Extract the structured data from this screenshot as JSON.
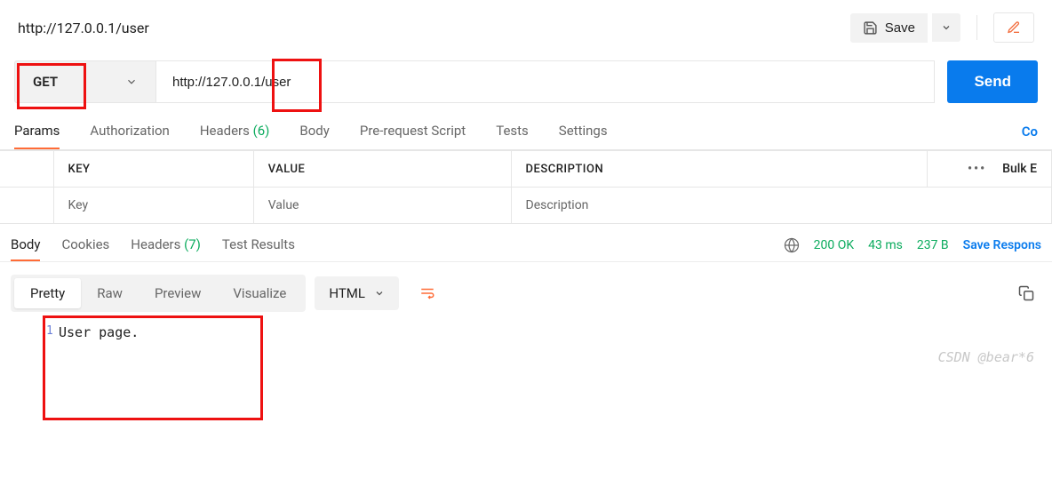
{
  "header": {
    "title": "http://127.0.0.1/user",
    "save_label": "Save"
  },
  "request": {
    "method": "GET",
    "url": "http://127.0.0.1/user",
    "send_label": "Send"
  },
  "req_tabs": {
    "params": "Params",
    "auth": "Authorization",
    "headers_label": "Headers",
    "headers_count": "(6)",
    "body": "Body",
    "prerequest": "Pre-request Script",
    "tests": "Tests",
    "settings": "Settings",
    "right_link": "Co"
  },
  "kv": {
    "key_header": "KEY",
    "value_header": "VALUE",
    "desc_header": "DESCRIPTION",
    "bulk": "Bulk E",
    "key_ph": "Key",
    "value_ph": "Value",
    "desc_ph": "Description"
  },
  "resp_tabs": {
    "body": "Body",
    "cookies": "Cookies",
    "headers_label": "Headers",
    "headers_count": "(7)",
    "test_results": "Test Results"
  },
  "status": {
    "code": "200 OK",
    "time": "43 ms",
    "size": "237 B",
    "save_response": "Save Respons"
  },
  "viewer": {
    "pretty": "Pretty",
    "raw": "Raw",
    "preview": "Preview",
    "visualize": "Visualize",
    "format": "HTML"
  },
  "response_body": {
    "line_number": "1",
    "content": "User page."
  },
  "watermark": "CSDN @bear*6"
}
